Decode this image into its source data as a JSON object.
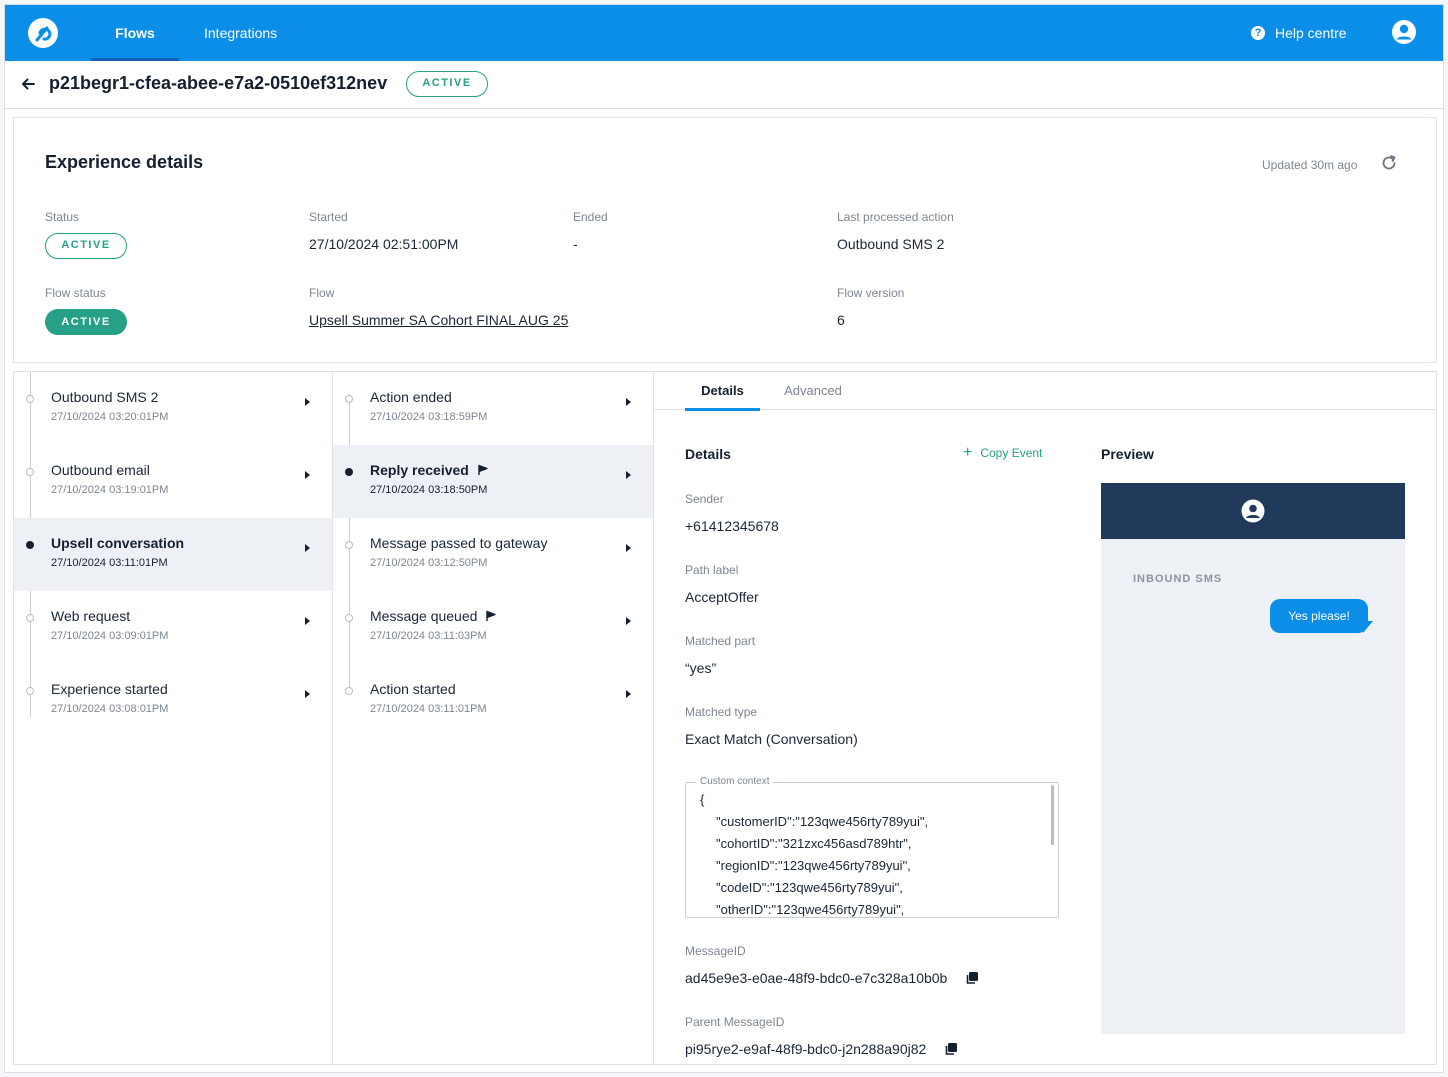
{
  "nav": {
    "tabs": [
      {
        "label": "Flows",
        "active": true
      },
      {
        "label": "Integrations",
        "active": false
      }
    ],
    "help_label": "Help centre"
  },
  "header": {
    "title": "p21begr1-cfea-abee-e7a2-0510ef312nev",
    "status_badge": "ACTIVE"
  },
  "experience": {
    "title": "Experience details",
    "updated": "Updated 30m ago",
    "fields": {
      "status_label": "Status",
      "status_value": "ACTIVE",
      "started_label": "Started",
      "started_value": "27/10/2024 02:51:00PM",
      "ended_label": "Ended",
      "ended_value": "-",
      "last_action_label": "Last processed action",
      "last_action_value": "Outbound SMS 2",
      "flow_status_label": "Flow status",
      "flow_status_value": "ACTIVE",
      "flow_label": "Flow",
      "flow_value": "Upsell Summer SA Cohort FINAL AUG 25",
      "flow_version_label": "Flow version",
      "flow_version_value": "6"
    }
  },
  "actions": [
    {
      "title": "Outbound SMS 2",
      "time": "27/10/2024 03:20:01PM",
      "selected": false
    },
    {
      "title": "Outbound email",
      "time": "27/10/2024 03:19:01PM",
      "selected": false
    },
    {
      "title": "Upsell conversation",
      "time": "27/10/2024 03:11:01PM",
      "selected": true
    },
    {
      "title": "Web request",
      "time": "27/10/2024 03:09:01PM",
      "selected": false
    },
    {
      "title": "Experience started",
      "time": "27/10/2024 03:08:01PM",
      "selected": false
    }
  ],
  "events": [
    {
      "title": "Action ended",
      "time": "27/10/2024 03:18:59PM",
      "selected": false,
      "flag": false
    },
    {
      "title": "Reply received",
      "time": "27/10/2024 03:18:50PM",
      "selected": true,
      "flag": true
    },
    {
      "title": "Message passed to gateway",
      "time": "27/10/2024 03:12:50PM",
      "selected": false,
      "flag": false
    },
    {
      "title": "Message queued",
      "time": "27/10/2024 03:11:03PM",
      "selected": false,
      "flag": true
    },
    {
      "title": "Action started",
      "time": "27/10/2024 03:11:01PM",
      "selected": false,
      "flag": false
    }
  ],
  "detail_tabs": [
    {
      "label": "Details",
      "active": true
    },
    {
      "label": "Advanced",
      "active": false
    }
  ],
  "details": {
    "title": "Details",
    "copy_event": "Copy Event",
    "sender_label": "Sender",
    "sender_value": "+61412345678",
    "path_label_label": "Path label",
    "path_label_value": "AcceptOffer",
    "matched_part_label": "Matched part",
    "matched_part_value": "“yes”",
    "matched_type_label": "Matched type",
    "matched_type_value": "Exact Match (Conversation)",
    "custom_context_label": "Custom context",
    "custom_context_lines": [
      "{",
      "\"customerID\":\"123qwe456rty789yui\",",
      "\"cohortID\":\"321zxc456asd789htr\",",
      "\"regionID\":\"123qwe456rty789yui\",",
      "\"codeID\":\"123qwe456rty789yui\",",
      "\"otherID\":\"123qwe456rty789yui\","
    ],
    "message_id_label": "MessageID",
    "message_id_value": "ad45e9e3-e0ae-48f9-bdc0-e7c328a10b0b",
    "parent_message_id_label": "Parent MessageID",
    "parent_message_id_value": "pi95rye2-e9af-48f9-bdc0-j2n288a90j82"
  },
  "preview": {
    "title": "Preview",
    "channel_label": "INBOUND SMS",
    "message": "Yes please!"
  },
  "colors": {
    "brand_blue": "#0b8ee8",
    "active_green": "#26a086",
    "preview_header": "#213a5c"
  },
  "icons": [
    "logo-icon",
    "help-icon",
    "user-avatar-icon",
    "back-arrow-icon",
    "refresh-icon",
    "chevron-right-icon",
    "flag-icon",
    "plus-icon",
    "copy-icon"
  ]
}
